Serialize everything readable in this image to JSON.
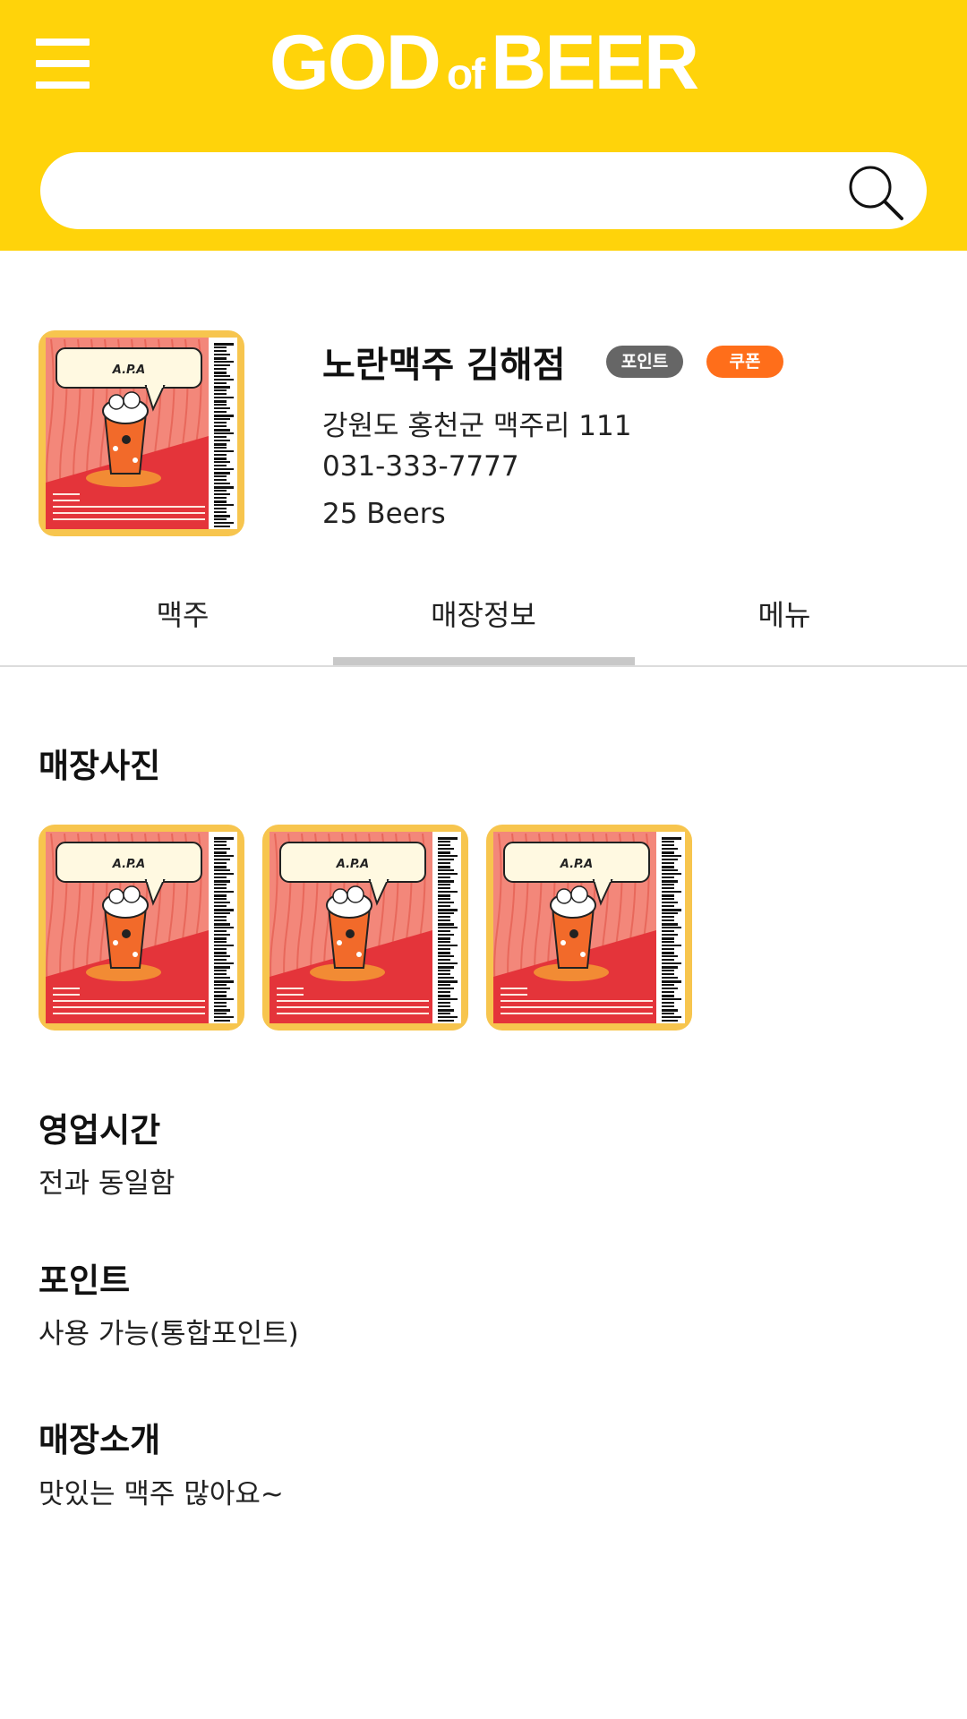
{
  "header": {
    "logo_part1": "GOD",
    "logo_part2": "of",
    "logo_part3": "BEER",
    "background_color": "#FFD30A",
    "menu_icon": "hamburger-menu-icon",
    "search_icon": "magnifier-icon"
  },
  "search": {
    "value": "",
    "placeholder": ""
  },
  "store": {
    "name": "노란맥주 김해점",
    "badge_point": "포인트",
    "badge_coupon": "쿠폰",
    "address": "강원도 홍천군 맥주리 111",
    "phone": "031-333-7777",
    "beer_count": "25 Beers",
    "thumbnail_label": "A.P.A"
  },
  "tabs": [
    {
      "label": "맥주",
      "active": false
    },
    {
      "label": "매장정보",
      "active": true
    },
    {
      "label": "메뉴",
      "active": false
    }
  ],
  "sections": {
    "photos_title": "매장사진",
    "photo_labels": [
      "A.P.A",
      "A.P.A",
      "A.P.A"
    ],
    "hours_title": "영업시간",
    "hours_body": "전과 동일함",
    "points_title": "포인트",
    "points_body": "사용 가능(통합포인트)",
    "intro_title": "매장소개",
    "intro_body": "맛있는 맥주 많아요~"
  },
  "colors": {
    "badge_point": "#666666",
    "badge_coupon": "#FF6E1A",
    "thumbnail_frame": "#F7C54E"
  }
}
